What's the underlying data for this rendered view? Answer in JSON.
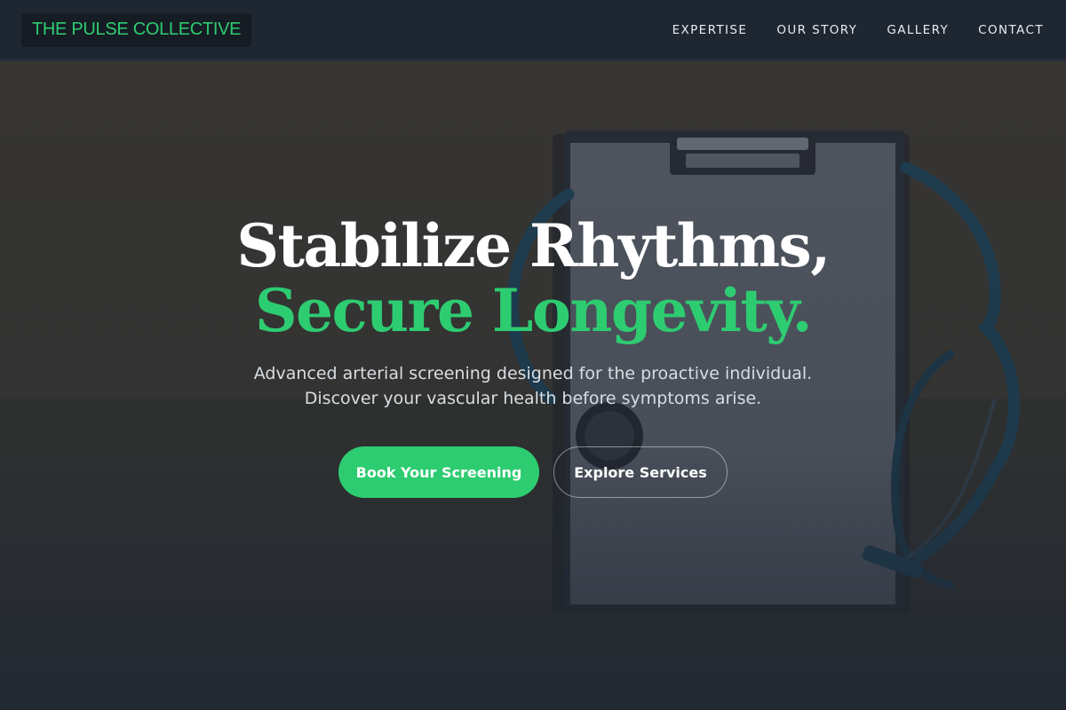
{
  "brand": {
    "name": "THE PULSE COLLECTIVE"
  },
  "nav": {
    "items": [
      {
        "label": "EXPERTISE"
      },
      {
        "label": "OUR STORY"
      },
      {
        "label": "GALLERY"
      },
      {
        "label": "CONTACT"
      }
    ]
  },
  "hero": {
    "headline_line1": "Stabilize Rhythms,",
    "headline_line2": "Secure Longevity.",
    "subtext_line1": "Advanced arterial screening designed for the proactive individual.",
    "subtext_line2": "Discover your vascular health before symptoms arise.",
    "primary_button": "Book Your Screening",
    "secondary_button": "Explore Services",
    "background_image": "clipboard-stethoscope-photo"
  },
  "colors": {
    "accent": "#2ecc71",
    "nav_background": "#1e2632",
    "text_light": "#ffffff"
  }
}
